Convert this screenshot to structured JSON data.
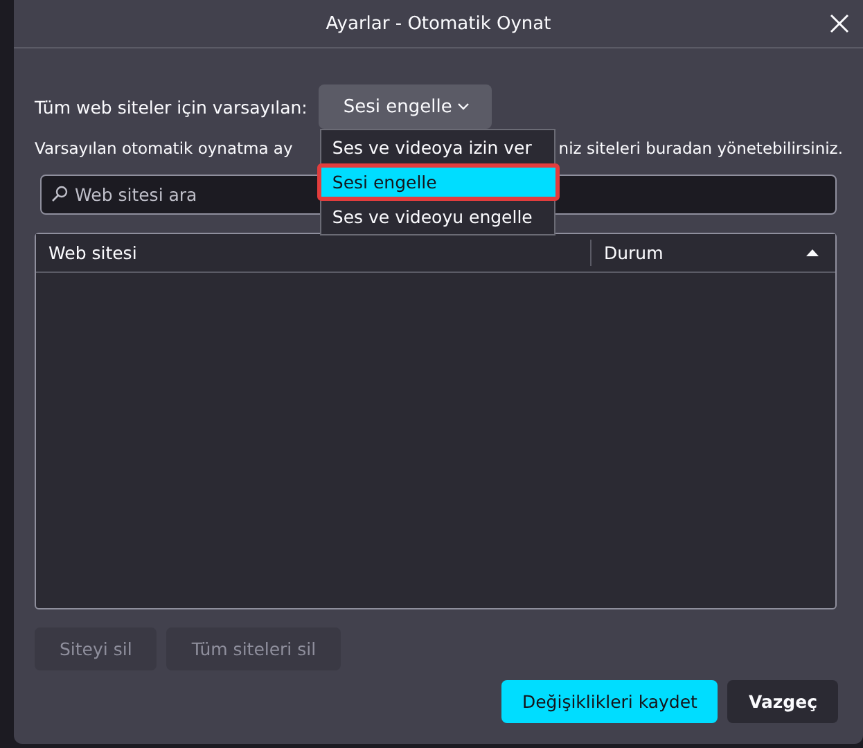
{
  "dialog": {
    "title": "Ayarlar - Otomatik Oynat"
  },
  "default_setting": {
    "label": "Tüm web siteler için varsayılan:",
    "value": "Sesi engelle"
  },
  "description": {
    "before_menu": "Varsayılan otomatik oynatma ay",
    "after_menu": "niz siteleri buradan yönetebilirsiniz."
  },
  "menu": {
    "items": [
      {
        "label": "Ses ve videoya izin ver",
        "selected": false,
        "outlined": false
      },
      {
        "label": "Sesi engelle",
        "selected": true,
        "outlined": true
      },
      {
        "label": "Ses ve videoyu engelle",
        "selected": false,
        "outlined": false
      }
    ]
  },
  "search": {
    "placeholder": "Web sitesi ara"
  },
  "table": {
    "columns": [
      {
        "label": "Web sitesi",
        "sorted": false
      },
      {
        "label": "Durum",
        "sorted": true
      }
    ]
  },
  "site_buttons": [
    {
      "label": "Siteyi sil",
      "disabled": true
    },
    {
      "label": "Tüm siteleri sil",
      "disabled": true
    }
  ],
  "footer_buttons": [
    {
      "label": "Değişiklikleri kaydet",
      "kind": "primary"
    },
    {
      "label": "Vazgeç",
      "kind": "secondary"
    }
  ]
}
